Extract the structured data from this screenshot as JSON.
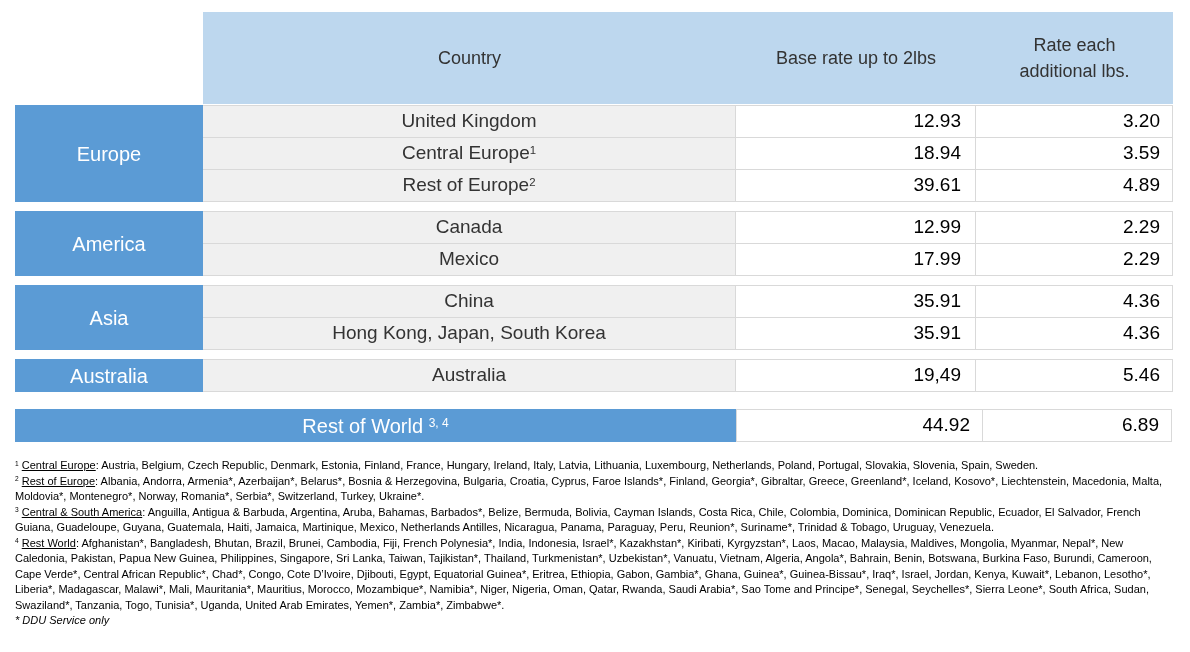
{
  "table": {
    "columns": [
      "Country",
      "Base rate up to 2lbs",
      "Rate each additional lbs."
    ],
    "groups": [
      {
        "region": "Europe",
        "rows": [
          {
            "country": "United Kingdom",
            "base_rate": "12.93",
            "additional_rate": "3.20"
          },
          {
            "country": "Central Europe$^{1}$",
            "base_rate": "18.94",
            "additional_rate": "3.59"
          },
          {
            "country": "Rest of Europe$^{2}$",
            "base_rate": "39.61",
            "additional_rate": "4.89"
          }
        ]
      },
      {
        "region": "America",
        "rows": [
          {
            "country": "Canada",
            "base_rate": "12.99",
            "additional_rate": "2.29"
          },
          {
            "country": "Mexico",
            "base_rate": "17.99",
            "additional_rate": "2.29"
          }
        ]
      },
      {
        "region": "Asia",
        "rows": [
          {
            "country": "China",
            "base_rate": "35.91",
            "additional_rate": "4.36"
          },
          {
            "country": "Hong Kong, Japan, South Korea",
            "base_rate": "35.91",
            "additional_rate": "4.36"
          }
        ]
      },
      {
        "region": "Australia",
        "rows": [
          {
            "country": "Australia",
            "base_rate": "19,49",
            "additional_rate": "5.46"
          }
        ]
      }
    ],
    "rest_of_world": {
      "label": "Rest of World $^{3, 4}$",
      "base_rate": "44.92",
      "additional_rate": "6.89"
    }
  },
  "footnotes": [
    {
      "mark": "1",
      "title": "Central Europe",
      "text": ": Austria, Belgium, Czech Republic, Denmark, Estonia, Finland, France, Hungary, Ireland, Italy, Latvia, Lithuania, Luxembourg, Netherlands, Poland, Portugal, Slovakia, Slovenia, Spain, Sweden."
    },
    {
      "mark": "2",
      "title": "Rest of Europe",
      "text": ": Albania, Andorra, Armenia*, Azerbaijan*, Belarus*, Bosnia & Herzegovina, Bulgaria, Croatia, Cyprus, Faroe Islands*, Finland, Georgia*, Gibraltar, Greece, Greenland*, Iceland, Kosovo*, Liechtenstein, Macedonia, Malta, Moldovia*, Montenegro*, Norway, Romania*, Serbia*, Switzerland, Turkey, Ukraine*."
    },
    {
      "mark": "3",
      "title": "Central & South America",
      "text": ": Anguilla, Antigua & Barbuda, Argentina, Aruba, Bahamas, Barbados*, Belize, Bermuda, Bolivia, Cayman Islands, Costa Rica, Chile, Colombia, Dominica, Dominican Republic, Ecuador, El Salvador, French Guiana, Guadeloupe, Guyana, Guatemala, Haiti, Jamaica, Martinique, Mexico, Netherlands Antilles, Nicaragua, Panama, Paraguay, Peru, Reunion*, Suriname*, Trinidad & Tobago, Uruguay, Venezuela."
    },
    {
      "mark": "4",
      "title": "Rest World",
      "text": ": Afghanistan*, Bangladesh, Bhutan, Brazil, Brunei, Cambodia, Fiji, French Polynesia*, India, Indonesia, Israel*, Kazakhstan*, Kiribati, Kyrgyzstan*, Laos, Macao, Malaysia, Maldives, Mongolia, Myanmar, Nepal*, New Caledonia, Pakistan, Papua New Guinea, Philippines, Singapore, Sri Lanka, Taiwan, Tajikistan*, Thailand, Turkmenistan*, Uzbekistan*, Vanuatu, Vietnam, Algeria, Angola*, Bahrain, Benin, Botswana, Burkina Faso, Burundi, Cameroon, Cape Verde*, Central African Republic*, Chad*, Congo, Cote D’Ivoire, Djibouti, Egypt, Equatorial Guinea*, Eritrea, Ethiopia, Gabon, Gambia*, Ghana, Guinea*, Guinea-Bissau*, Iraq*, Israel, Jordan, Kenya, Kuwait*, Lebanon, Lesotho*, Liberia*, Madagascar, Malawi*, Mali, Mauritania*, Mauritius, Morocco, Mozambique*, Namibia*, Niger, Nigeria, Oman, Qatar, Rwanda, Saudi Arabia*, Sao Tome and Principe*, Senegal, Seychelles*, Sierra Leone*, South Africa, Sudan, Swaziland*, Tanzania, Togo, Tunisia*, Uganda, United Arab Emirates, Yemen*, Zambia*, Zimbabwe*."
    }
  ],
  "note": "* DDU Service only"
}
